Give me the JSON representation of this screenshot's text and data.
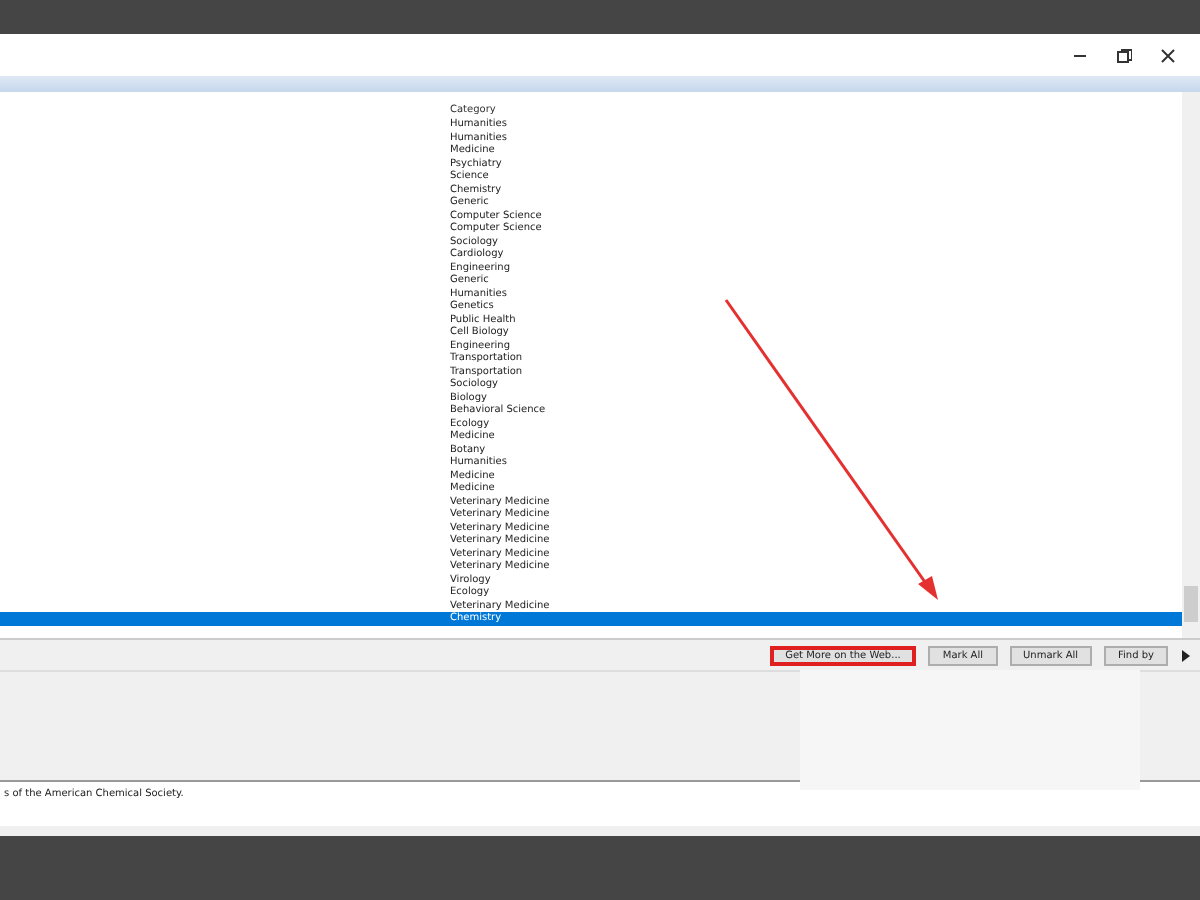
{
  "list": {
    "column": "Category",
    "rows": [
      {
        "label": "Humanities",
        "selected": false
      },
      {
        "label": "Humanities",
        "selected": false
      },
      {
        "label": "Medicine",
        "selected": false
      },
      {
        "label": "Psychiatry",
        "selected": false
      },
      {
        "label": "Science",
        "selected": false
      },
      {
        "label": "Chemistry",
        "selected": false
      },
      {
        "label": "Generic",
        "selected": false
      },
      {
        "label": "Computer Science",
        "selected": false
      },
      {
        "label": "Computer Science",
        "selected": false
      },
      {
        "label": "Sociology",
        "selected": false
      },
      {
        "label": "Cardiology",
        "selected": false
      },
      {
        "label": "Engineering",
        "selected": false
      },
      {
        "label": "Generic",
        "selected": false
      },
      {
        "label": "Humanities",
        "selected": false
      },
      {
        "label": "Genetics",
        "selected": false
      },
      {
        "label": "Public Health",
        "selected": false
      },
      {
        "label": "Cell Biology",
        "selected": false
      },
      {
        "label": "Engineering",
        "selected": false
      },
      {
        "label": "Transportation",
        "selected": false
      },
      {
        "label": "Transportation",
        "selected": false
      },
      {
        "label": "Sociology",
        "selected": false
      },
      {
        "label": "Biology",
        "selected": false
      },
      {
        "label": "Behavioral Science",
        "selected": false
      },
      {
        "label": "Ecology",
        "selected": false
      },
      {
        "label": "Medicine",
        "selected": false
      },
      {
        "label": "Botany",
        "selected": false
      },
      {
        "label": "Humanities",
        "selected": false
      },
      {
        "label": "Medicine",
        "selected": false
      },
      {
        "label": "Medicine",
        "selected": false
      },
      {
        "label": "Veterinary Medicine",
        "selected": false
      },
      {
        "label": "Veterinary Medicine",
        "selected": false
      },
      {
        "label": "Veterinary Medicine",
        "selected": false
      },
      {
        "label": "Veterinary Medicine",
        "selected": false
      },
      {
        "label": "Veterinary Medicine",
        "selected": false
      },
      {
        "label": "Veterinary Medicine",
        "selected": false
      },
      {
        "label": "Virology",
        "selected": false
      },
      {
        "label": "Ecology",
        "selected": false
      },
      {
        "label": "Veterinary Medicine",
        "selected": false
      },
      {
        "label": "Chemistry",
        "selected": true
      }
    ]
  },
  "buttons": [
    {
      "label": "Get More on the Web...",
      "highlighted": true
    },
    {
      "label": "Mark All",
      "highlighted": false
    },
    {
      "label": "Unmark All",
      "highlighted": false
    },
    {
      "label": "Find by",
      "highlighted": false
    }
  ],
  "description": "s of the American Chemical Society."
}
